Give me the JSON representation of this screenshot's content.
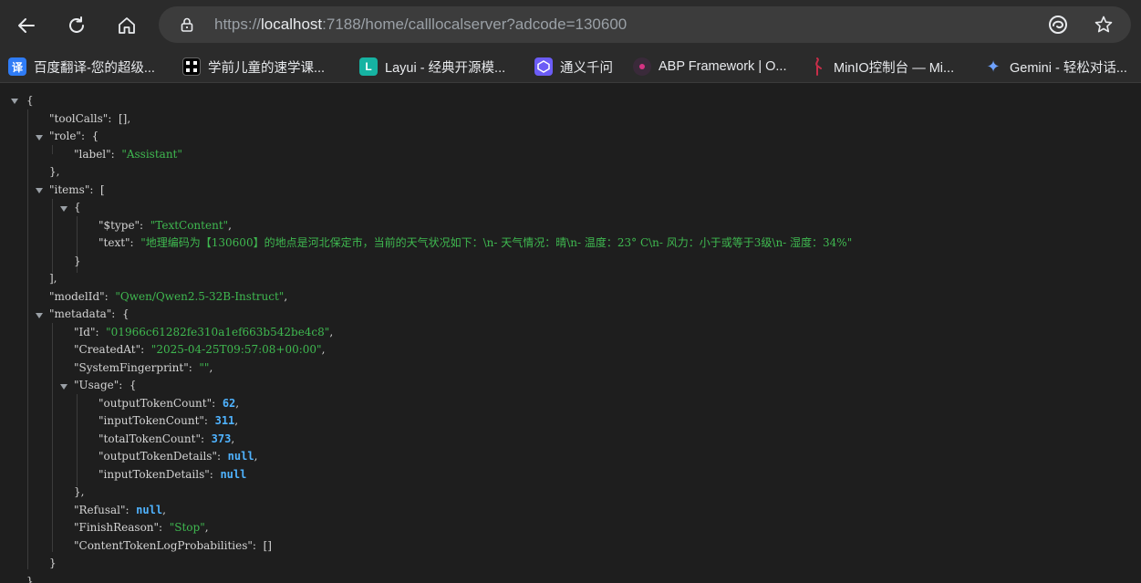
{
  "browser": {
    "url_scheme": "https://",
    "url_host": "localhost",
    "url_rest": ":7188/home/calllocalserver?adcode=130600",
    "icons": {
      "back": "back-arrow-icon",
      "reload": "reload-icon",
      "home": "home-icon",
      "lock": "lock-icon",
      "edge": "edge-extension-icon",
      "star": "star-icon"
    }
  },
  "bookmarks": [
    {
      "label": "百度翻译-您的超级...",
      "icon_char": "译",
      "icon_bg": "#2f7cf6"
    },
    {
      "label": "学前儿童的速学课...",
      "icon_char": "",
      "icon_bg": "#000000"
    },
    {
      "label": "Layui - 经典开源模...",
      "icon_char": "L",
      "icon_bg": "#16b3a2"
    },
    {
      "label": "通义千问",
      "icon_char": "",
      "icon_bg": "#6b5cf6"
    },
    {
      "label": "ABP Framework | O...",
      "icon_char": "",
      "icon_bg": "#3a2a3a"
    },
    {
      "label": "MinIO控制台 — Mi...",
      "icon_char": "",
      "icon_bg": "#2b2b2b"
    },
    {
      "label": "Gemini - 轻松对话...",
      "icon_char": "✦",
      "icon_bg": "#2b2b2b"
    }
  ],
  "json": {
    "toolCalls": "[]",
    "role_label": "Assistant",
    "item_type": "TextContent",
    "item_text": "地理编码为【130600】的地点是河北保定市，当前的天气状况如下：\\n- 天气情况：晴\\n- 温度：23° C\\n- 风力：小于或等于3级\\n- 湿度：34%",
    "modelId": "Qwen/Qwen2.5-32B-Instruct",
    "metadata": {
      "Id": "01966c61282fe310a1ef663b542be4c8",
      "CreatedAt": "2025-04-25T09:57:08+00:00",
      "SystemFingerprint": "",
      "Usage": {
        "outputTokenCount": 62,
        "inputTokenCount": 311,
        "totalTokenCount": 373,
        "outputTokenDetails": "null",
        "inputTokenDetails": "null"
      },
      "Refusal": "null",
      "FinishReason": "Stop",
      "ContentTokenLogProbabilities": "[]"
    }
  },
  "colors": {
    "string": "#3fb950",
    "number": "#4fb3ff",
    "background": "#1e1e1e"
  }
}
